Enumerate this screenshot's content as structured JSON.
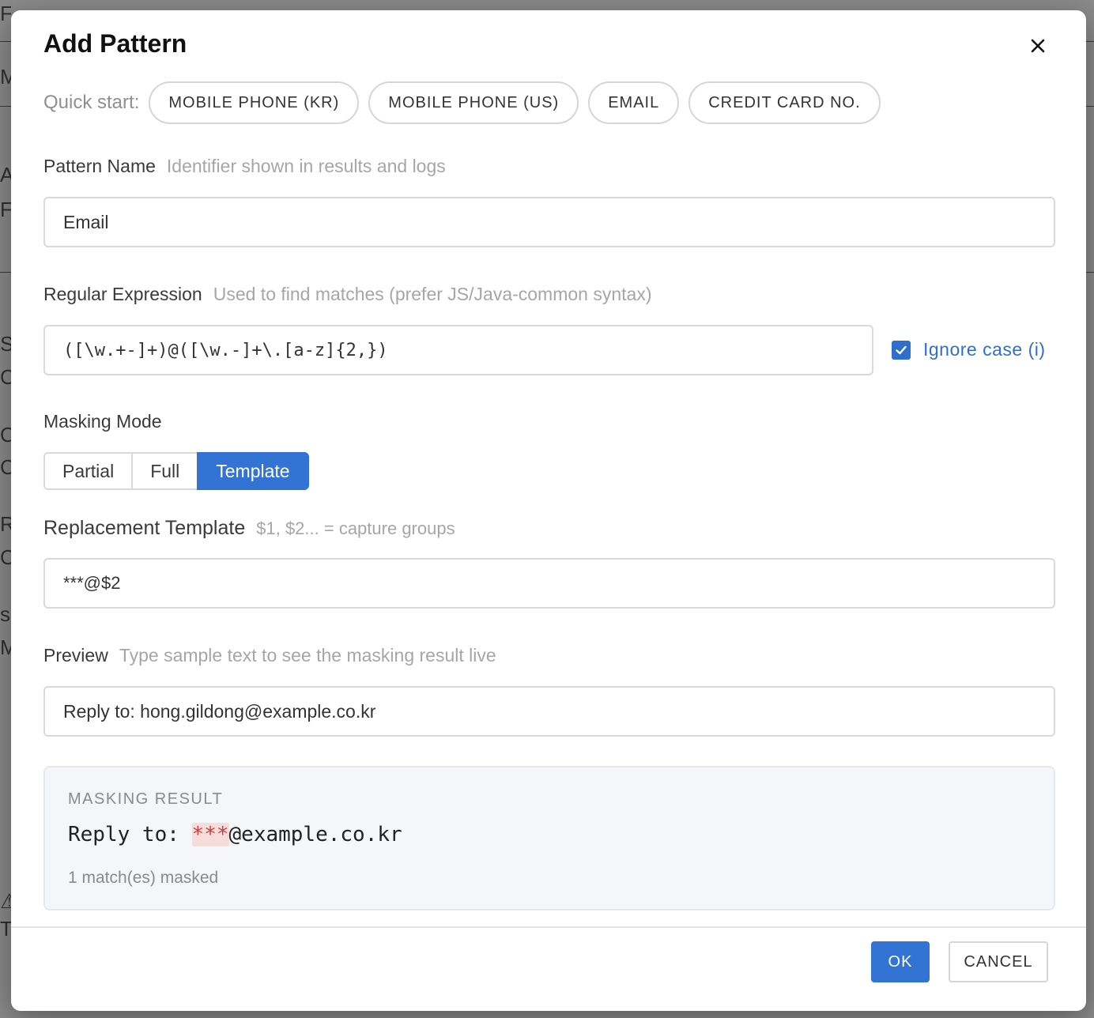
{
  "dialog": {
    "title": "Add Pattern",
    "close_icon": "close-icon"
  },
  "quick_start": {
    "label": "Quick start:",
    "chips": [
      "MOBILE PHONE (KR)",
      "MOBILE PHONE (US)",
      "EMAIL",
      "CREDIT CARD NO."
    ]
  },
  "pattern_name": {
    "label": "Pattern Name",
    "hint": "Identifier shown in results and logs",
    "value": "Email"
  },
  "regex": {
    "label": "Regular Expression",
    "hint": "Used to find matches (prefer JS/Java-common syntax)",
    "value": "([\\w.+-]+)@([\\w.-]+\\.[a-z]{2,})",
    "ignore_case_label": "Ignore case (i)",
    "ignore_case_checked": true
  },
  "masking_mode": {
    "label": "Masking Mode",
    "options": [
      "Partial",
      "Full",
      "Template"
    ],
    "selected": "Template"
  },
  "replacement_template": {
    "label": "Replacement Template",
    "hint": "$1, $2... = capture groups",
    "value": "***@$2"
  },
  "preview": {
    "label": "Preview",
    "hint": "Type sample text to see the masking result live",
    "value": "Reply to: hong.gildong@example.co.kr"
  },
  "result": {
    "title": "MASKING RESULT",
    "prefix": "Reply to: ",
    "masked": "***",
    "suffix": "@example.co.kr",
    "count": "1 match(es) masked"
  },
  "footer": {
    "ok_label": "OK",
    "cancel_label": "CANCEL"
  },
  "colors": {
    "accent": "#3273d3",
    "masked_text": "#d43b3b",
    "masked_bg": "#f7dcdc"
  }
}
